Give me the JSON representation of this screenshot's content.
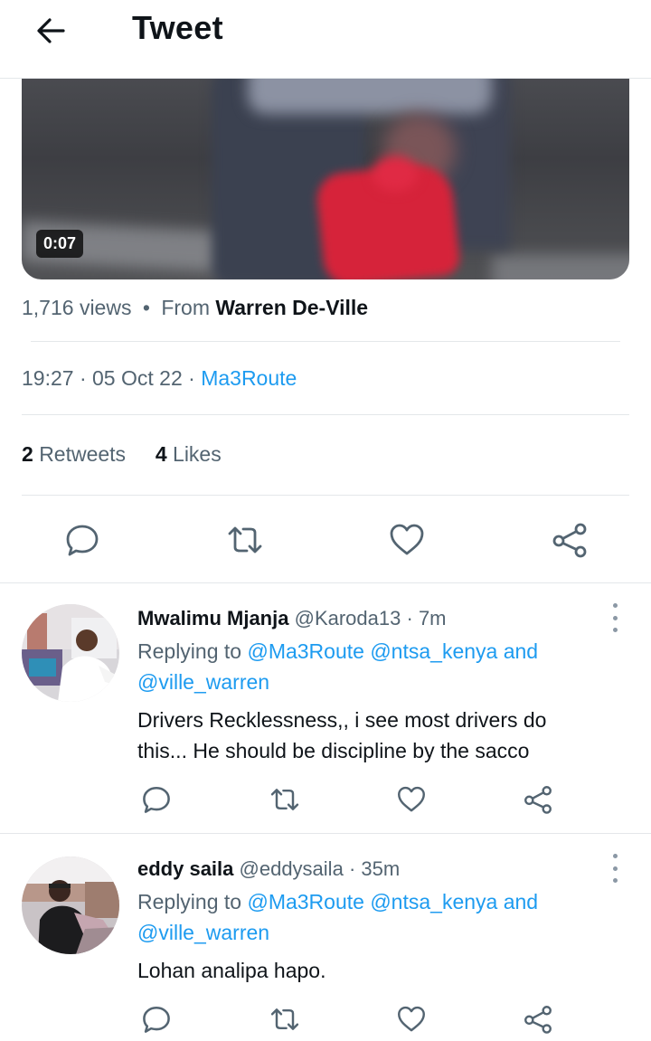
{
  "header": {
    "back_icon": "arrow-left-icon",
    "title": "Tweet"
  },
  "video": {
    "duration": "0:07"
  },
  "tweet": {
    "views": "1,716 views",
    "from_prefix": "From",
    "from_name": "Warren De-Ville",
    "time": "19:27",
    "date": "05 Oct 22",
    "source": "Ma3Route",
    "retweets_count": "2",
    "retweets_label": "Retweets",
    "likes_count": "4",
    "likes_label": "Likes"
  },
  "icons": {
    "reply": "reply-icon",
    "retweet": "retweet-icon",
    "like": "heart-icon",
    "share": "share-icon",
    "more": "more-vertical-icon"
  },
  "colors": {
    "accent": "#1d9bf0",
    "secondary_text": "#536471",
    "primary_text": "#0f1419",
    "divider": "#e4e7ea"
  },
  "replies": [
    {
      "name": "Mwalimu Mjanja",
      "handle": "@Karoda13",
      "time": "7m",
      "replying_prefix": "Replying to",
      "mention1": "@Ma3Route",
      "mention2": "@ntsa_kenya",
      "and": "and",
      "mention3": "@ville_warren",
      "text_line1": "Drivers Recklessness,, i see most drivers do",
      "text_line2": "this... He should be discipline by the sacco"
    },
    {
      "name": "eddy saila",
      "handle": "@eddysaila",
      "time": "35m",
      "replying_prefix": "Replying to",
      "mention1": "@Ma3Route",
      "mention2": "@ntsa_kenya",
      "and": "and",
      "mention3": "@ville_warren",
      "text_line1": "Lohan analipa hapo."
    }
  ]
}
